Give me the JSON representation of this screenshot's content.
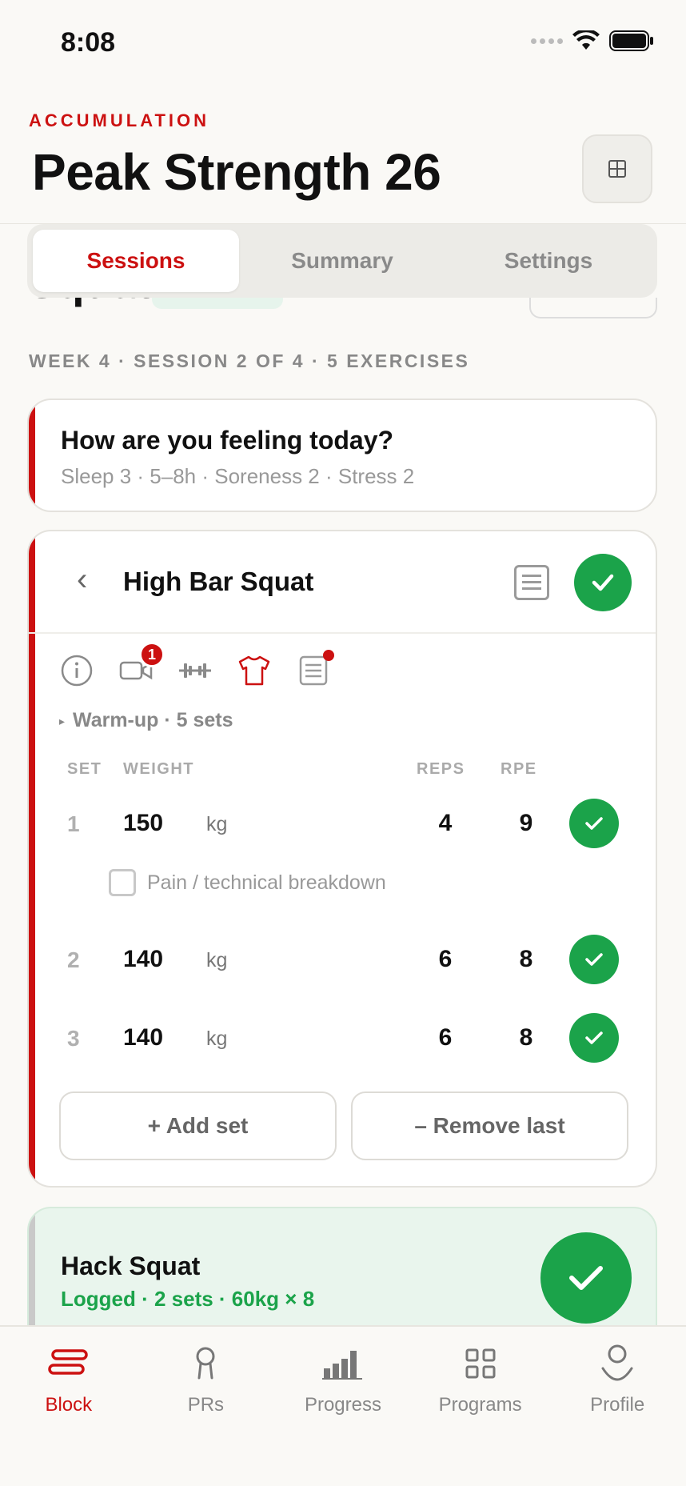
{
  "status": {
    "time": "8:08"
  },
  "header": {
    "phase": "ACCUMULATION",
    "title": "Peak Strength 26"
  },
  "tabs": [
    {
      "label": "Sessions",
      "active": true
    },
    {
      "label": "Summary",
      "active": false
    },
    {
      "label": "Settings",
      "active": false
    }
  ],
  "session": {
    "title_partial": "Squat",
    "meta": "WEEK 4 · SESSION 2 OF 4 · 5 EXERCISES"
  },
  "readiness": {
    "title": "How are you feeling today?",
    "details": "Sleep 3 · 5–8h · Soreness 2 · Stress 2"
  },
  "exercise": {
    "back_glyph": "‹",
    "name": "High Bar Squat",
    "video_badge": "1",
    "warmup": "Warm-up · 5 sets",
    "columns": {
      "set": "SET",
      "weight": "WEIGHT",
      "reps": "REPS",
      "rpe": "RPE"
    },
    "sets": [
      {
        "num": "1",
        "weight": "150",
        "unit": "kg",
        "reps": "4",
        "rpe": "9"
      },
      {
        "num": "2",
        "weight": "140",
        "unit": "kg",
        "reps": "6",
        "rpe": "8"
      },
      {
        "num": "3",
        "weight": "140",
        "unit": "kg",
        "reps": "6",
        "rpe": "8"
      }
    ],
    "flag_label": "Pain / technical breakdown",
    "add_set": "+ Add set",
    "remove_last": "– Remove last"
  },
  "next_exercise": {
    "name": "Hack Squat",
    "status": "Logged · 2 sets · 60kg × 8"
  },
  "bottom_nav": [
    {
      "label": "Block",
      "icon": "block-icon",
      "active": true
    },
    {
      "label": "PRs",
      "icon": "pr-icon",
      "active": false
    },
    {
      "label": "Progress",
      "icon": "progress-icon",
      "active": false
    },
    {
      "label": "Programs",
      "icon": "programs-icon",
      "active": false
    },
    {
      "label": "Profile",
      "icon": "profile-icon",
      "active": false
    }
  ],
  "colors": {
    "accent": "#cc1111",
    "success": "#1ba34a",
    "success_bg": "#e9f5ed"
  }
}
